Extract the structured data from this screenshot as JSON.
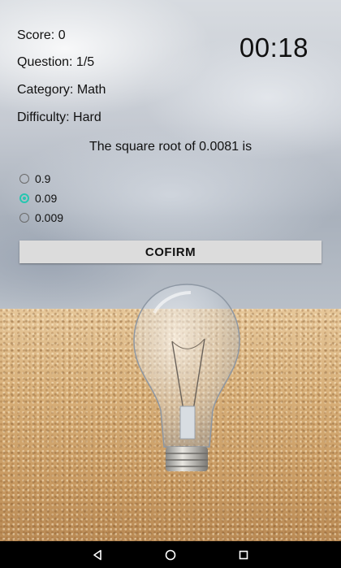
{
  "quiz": {
    "score": "Score: 0",
    "question_progress": "Question: 1/5",
    "category": "Category: Math",
    "difficulty": "Difficulty: Hard",
    "timer": "00:18",
    "question_text": "The square root of 0.0081 is",
    "options": [
      {
        "label": "0.9",
        "selected": false
      },
      {
        "label": "0.09",
        "selected": true
      },
      {
        "label": "0.009",
        "selected": false
      }
    ],
    "confirm_label": "COFIRM"
  },
  "colors": {
    "accent": "#26c6b0",
    "button_bg": "#dcdcdc",
    "navbar_bg": "#000000"
  },
  "icons": {
    "back": "back-triangle-icon",
    "home": "home-circle-icon",
    "recents": "recents-square-icon"
  }
}
